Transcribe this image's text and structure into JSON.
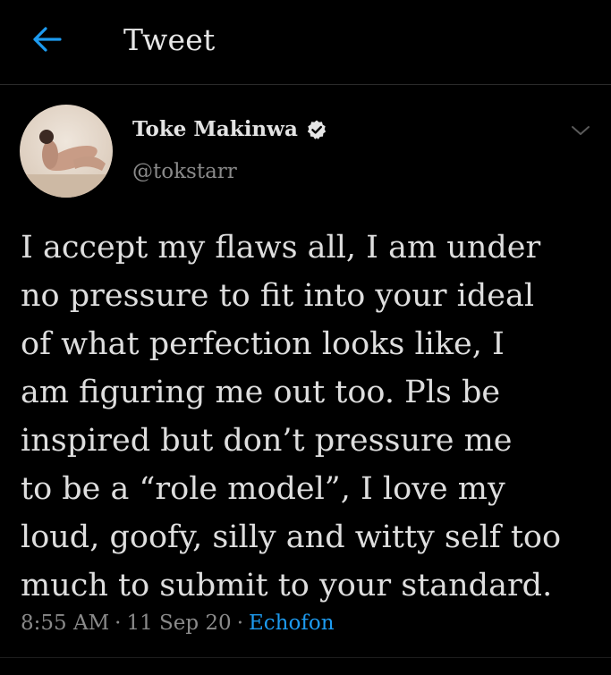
{
  "header": {
    "title": "Tweet",
    "back_icon": "arrow-left-icon"
  },
  "author": {
    "name": "Toke Makinwa",
    "handle": "@tokstarr",
    "verified_icon": "verified-badge-icon",
    "avatar_icon": "profile-photo"
  },
  "tweet": {
    "lines": [
      "I accept my flaws all, I am under",
      "no pressure to fit into your ideal",
      "of what perfection looks like, I",
      "am figuring me out too. Pls be",
      "inspired but don’t pressure me",
      "to be a “role model”, I love my",
      "loud, goofy, silly and witty self too",
      "much to submit to your standard."
    ]
  },
  "meta": {
    "time": "8:55 AM",
    "sep": "·",
    "date": "11 Sep 20",
    "source": "Echofon"
  },
  "colors": {
    "background": "#000000",
    "accent": "#1d9bf0",
    "secondary_text": "#8a8a8a"
  }
}
